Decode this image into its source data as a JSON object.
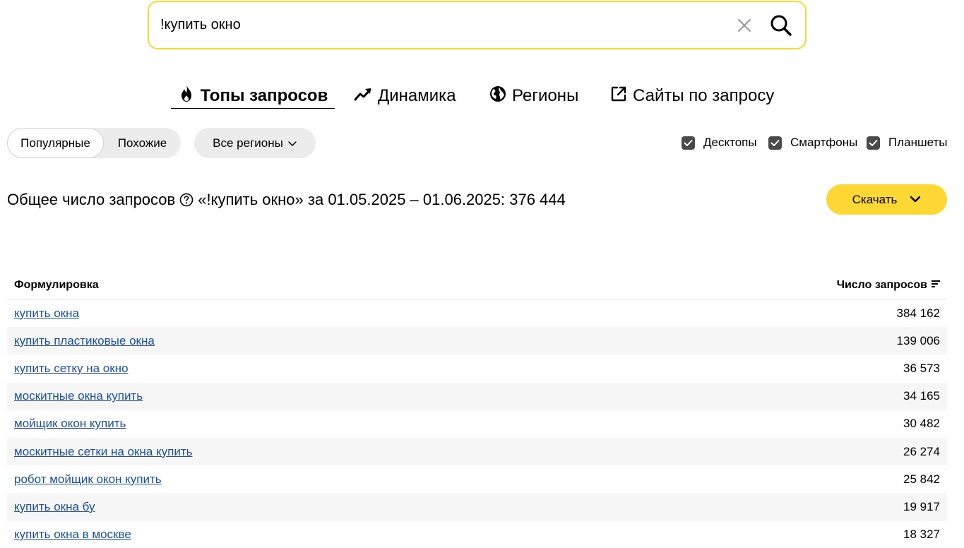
{
  "search": {
    "value": "!купить окно",
    "placeholder": ""
  },
  "tabs": [
    {
      "label": "Топы запросов",
      "icon": "fire-icon",
      "active": true
    },
    {
      "label": "Динамика",
      "icon": "trend-up-icon",
      "active": false
    },
    {
      "label": "Регионы",
      "icon": "globe-icon",
      "active": false
    },
    {
      "label": "Сайты по запросу",
      "icon": "external-link-icon",
      "active": false
    }
  ],
  "filters": {
    "mode_popular": "Популярные",
    "mode_similar": "Похожие",
    "region": "Все регионы",
    "devices": [
      {
        "label": "Десктопы",
        "checked": true
      },
      {
        "label": "Смартфоны",
        "checked": true
      },
      {
        "label": "Планшеты",
        "checked": true
      }
    ]
  },
  "summary": {
    "label": "Общее число запросов",
    "detail": "«!купить окно» за 01.05.2025 – 01.06.2025: 376 444"
  },
  "download_label": "Скачать",
  "table": {
    "col_phrase": "Формулировка",
    "col_count": "Число запросов",
    "rows": [
      {
        "phrase": "купить окна",
        "count": "384 162"
      },
      {
        "phrase": "купить пластиковые окна",
        "count": "139 006"
      },
      {
        "phrase": "купить сетку на окно",
        "count": "36 573"
      },
      {
        "phrase": "москитные окна купить",
        "count": "34 165"
      },
      {
        "phrase": "мойщик окон купить",
        "count": "30 482"
      },
      {
        "phrase": "москитные сетки на окна купить",
        "count": "26 274"
      },
      {
        "phrase": "робот мойщик окон купить",
        "count": "25 842"
      },
      {
        "phrase": "купить окна бу",
        "count": "19 917"
      },
      {
        "phrase": "купить окна в москве",
        "count": "18 327"
      }
    ]
  },
  "colors": {
    "accent": "#fdd835",
    "link": "#1a4fa8",
    "row_alt": "#f6f6f6",
    "checkbox": "#4a4a4a"
  }
}
